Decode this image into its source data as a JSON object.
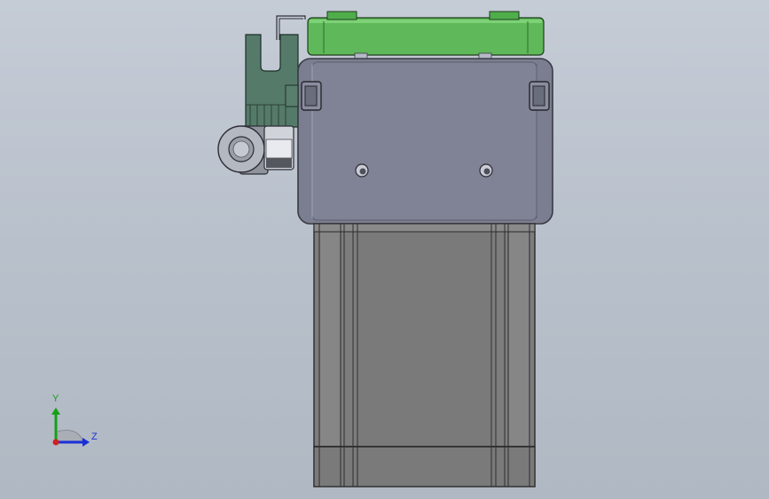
{
  "viewport": {
    "background_top": "#c5ccd6",
    "background_bottom": "#b0b8c3"
  },
  "colors": {
    "housing": "#7b7e90",
    "housing_edge": "#3a3b44",
    "motor_body": "#7d7d7d",
    "cover_green": "#5fb85a",
    "bracket": "#557a6a",
    "axis_y": "#16a016",
    "axis_z": "#1b2fd6",
    "axis_x": "#d02020"
  },
  "triad": {
    "y_label": "Y",
    "z_label": "Z"
  }
}
